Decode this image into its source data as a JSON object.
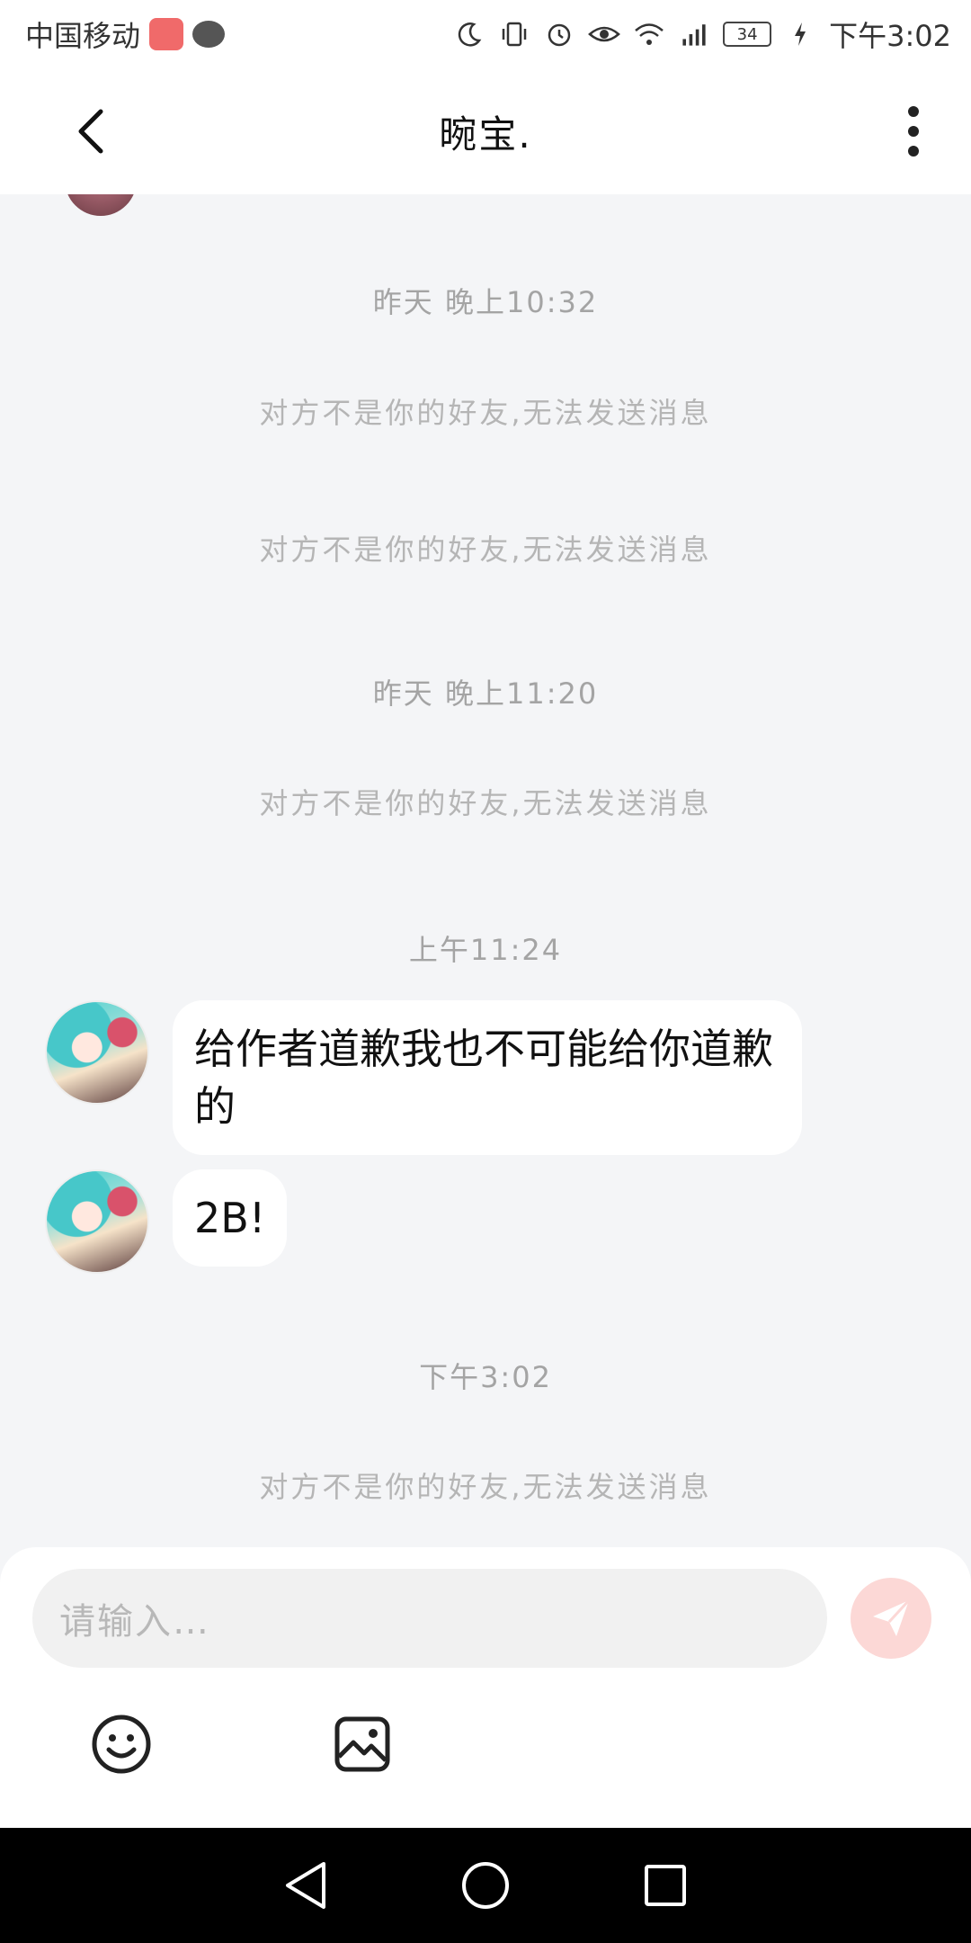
{
  "status_bar": {
    "carrier": "中国移动",
    "battery": "34",
    "time": "下午3:02"
  },
  "header": {
    "title": "晼宝."
  },
  "messages": {
    "ts1": "昨天 晚上10:32",
    "note1": "对方不是你的好友,无法发送消息",
    "note2": "对方不是你的好友,无法发送消息",
    "ts2": "昨天 晚上11:20",
    "note3": "对方不是你的好友,无法发送消息",
    "ts3": "上午11:24",
    "bubble1": "给作者道歉我也不可能给你道歉的",
    "bubble2": "2B!",
    "ts4": "下午3:02",
    "note4": "对方不是你的好友,无法发送消息"
  },
  "input": {
    "placeholder": "请输入…"
  },
  "icons": {
    "back": "chevron-left-icon",
    "more": "more-vertical-icon",
    "send": "send-icon",
    "emoji": "emoji-icon",
    "image": "image-icon"
  },
  "colors": {
    "background": "#f4f5f7",
    "send_button": "#fcd8d6",
    "nav_bar": "#000000"
  }
}
